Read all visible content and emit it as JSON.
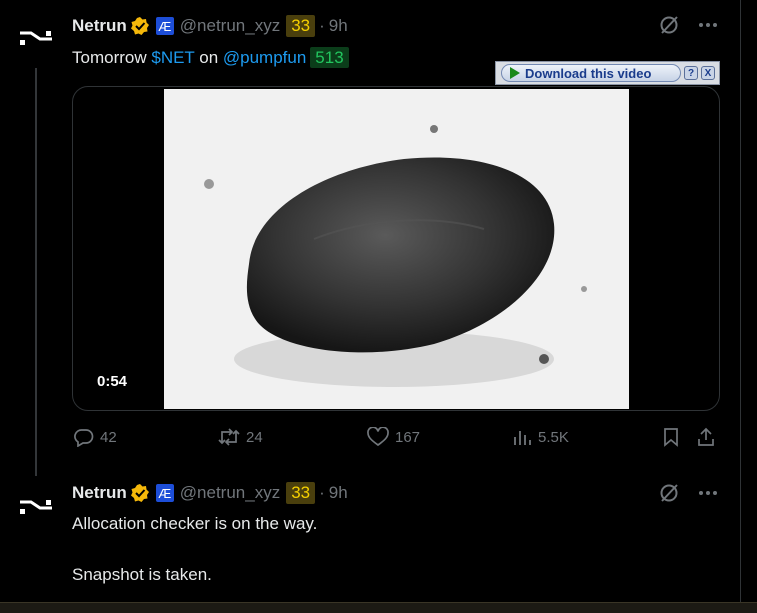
{
  "tweets": [
    {
      "name": "Netrun",
      "ae_badge": "Æ",
      "handle": "@netrun_xyz",
      "score": "33",
      "separator": "·",
      "time": "9h",
      "text": {
        "before": "Tomorrow ",
        "cashtag": "$NET",
        "middle": " on ",
        "mention": "@pumpfun",
        "badge": "513"
      },
      "video_duration": "0:54",
      "stats": {
        "replies": "42",
        "retweets": "24",
        "likes": "167",
        "views": "5.5K"
      }
    },
    {
      "name": "Netrun",
      "ae_badge": "Æ",
      "handle": "@netrun_xyz",
      "score": "33",
      "separator": "·",
      "time": "9h",
      "line1": "Allocation checker is on the way.",
      "line2": "Snapshot is taken."
    }
  ],
  "download_bar": {
    "label": "Download this video",
    "help": "?",
    "close": "X"
  },
  "colors": {
    "link": "#1d9bf0",
    "verified": "#f5b80a",
    "score_badge_text": "#f5d000",
    "green_badge_text": "#22c55e"
  },
  "icons": [
    "avatar-logo",
    "verified-icon",
    "grok-icon",
    "more-icon",
    "reply-icon",
    "retweet-icon",
    "like-icon",
    "views-icon",
    "bookmark-icon",
    "share-icon"
  ]
}
